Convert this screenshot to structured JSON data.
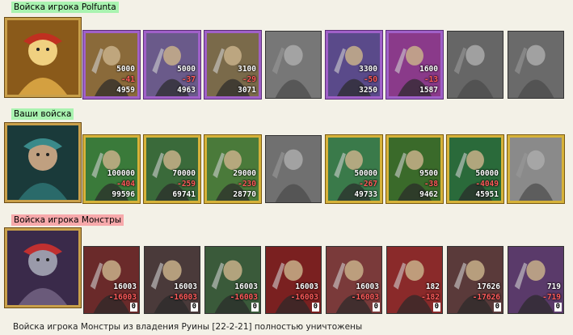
{
  "sections": [
    {
      "label": "Войска игрока Polfunta",
      "label_color": "#a9f3b0",
      "hero_icon": "hero-cavalier-portrait",
      "units": [
        {
          "name": "beast-unit",
          "frame": "purple",
          "c1": "5000",
          "c2": "-41",
          "c3": "4959",
          "tint": "#8a6a3a"
        },
        {
          "name": "swordsman-unit",
          "frame": "purple",
          "c1": "5000",
          "c2": "-37",
          "c3": "4963",
          "tint": "#6a5a8a"
        },
        {
          "name": "crossbowman-unit",
          "frame": "purple",
          "c1": "3100",
          "c2": "-29",
          "c3": "3071",
          "tint": "#7a6a4a"
        },
        {
          "name": "griffin-unit-gray",
          "frame": "none",
          "c1": "",
          "c2": "",
          "c3": "",
          "tint": "#777777"
        },
        {
          "name": "archer-unit",
          "frame": "purple",
          "c1": "3300",
          "c2": "-50",
          "c3": "3250",
          "tint": "#5a4a8a"
        },
        {
          "name": "mage-unit",
          "frame": "purple",
          "c1": "1600",
          "c2": "-13",
          "c3": "1587",
          "tint": "#8a3a8a"
        },
        {
          "name": "reaper-unit-gray",
          "frame": "none",
          "c1": "",
          "c2": "",
          "c3": "",
          "tint": "#666666"
        },
        {
          "name": "knight-unit-gray",
          "frame": "none",
          "c1": "",
          "c2": "",
          "c3": "",
          "tint": "#6a6a6a"
        }
      ]
    },
    {
      "label": "Ваши войска",
      "label_color": "#a9f3b0",
      "hero_icon": "hero-ranger-portrait",
      "units": [
        {
          "name": "dwarf-unit",
          "frame": "gold",
          "c1": "100000",
          "c2": "-404",
          "c3": "99596",
          "tint": "#3a7a3a"
        },
        {
          "name": "warrior-unit",
          "frame": "gold",
          "c1": "70000",
          "c2": "-259",
          "c3": "69741",
          "tint": "#3a6a3a"
        },
        {
          "name": "spearman-unit",
          "frame": "gold",
          "c1": "29000",
          "c2": "-230",
          "c3": "28770",
          "tint": "#4a7a3a"
        },
        {
          "name": "gargoyle-unit-gray",
          "frame": "none",
          "c1": "",
          "c2": "",
          "c3": "",
          "tint": "#707070"
        },
        {
          "name": "elf-archer-unit",
          "frame": "gold",
          "c1": "50000",
          "c2": "-267",
          "c3": "49733",
          "tint": "#3a7a4a"
        },
        {
          "name": "druid-unit",
          "frame": "gold",
          "c1": "9500",
          "c2": "-38",
          "c3": "9462",
          "tint": "#3a6a2a"
        },
        {
          "name": "guardian-unit",
          "frame": "gold",
          "c1": "50000",
          "c2": "-4049",
          "c3": "45951",
          "tint": "#2a6a3a"
        },
        {
          "name": "treant-unit-gray",
          "frame": "gold",
          "c1": "",
          "c2": "",
          "c3": "",
          "tint": "#8a8a8a"
        }
      ]
    },
    {
      "label": "Войска игрока Монстры",
      "label_color": "#f7a9ab",
      "hero_icon": "hero-werewolf-portrait",
      "units": [
        {
          "name": "demon-unit",
          "frame": "none",
          "c1": "16003",
          "c2": "-16003",
          "badge": "0",
          "tint": "#6a2a2a"
        },
        {
          "name": "golem-unit",
          "frame": "none",
          "c1": "16003",
          "c2": "-16003",
          "badge": "0",
          "tint": "#4a3a3a"
        },
        {
          "name": "orc-unit",
          "frame": "none",
          "c1": "16003",
          "c2": "-16003",
          "badge": "0",
          "tint": "#3a5a3a"
        },
        {
          "name": "devil-unit",
          "frame": "none",
          "c1": "16003",
          "c2": "-16003",
          "badge": "0",
          "tint": "#7a2020"
        },
        {
          "name": "hydra-unit",
          "frame": "none",
          "c1": "16003",
          "c2": "-16003",
          "badge": "0",
          "tint": "#7a3a3a"
        },
        {
          "name": "dragon-unit",
          "frame": "none",
          "c1": "182",
          "c2": "-182",
          "badge": "0",
          "tint": "#8a2a2a"
        },
        {
          "name": "wyrm-unit",
          "frame": "none",
          "c1": "17626",
          "c2": "-17626",
          "badge": "0",
          "tint": "#5a3a3a"
        },
        {
          "name": "fiend-unit",
          "frame": "none",
          "c1": "719",
          "c2": "-719",
          "badge": "0",
          "tint": "#5a3a6a"
        }
      ]
    }
  ],
  "footer": "Войска игрока Монстры из владения Руины [22-2-21] полностью уничтожены"
}
